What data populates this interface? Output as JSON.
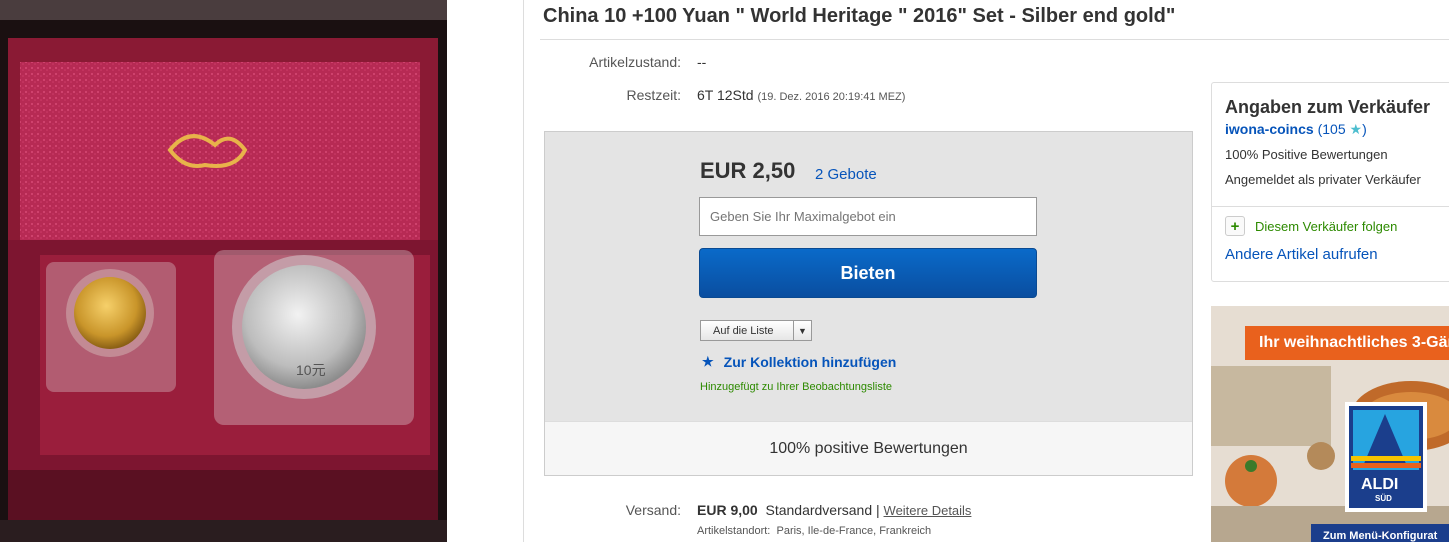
{
  "title": "China 10 +100 Yuan \" World Heritage \" 2016\" Set - Silber end gold\"",
  "condition": {
    "label": "Artikelzustand:",
    "value": "--"
  },
  "time_left": {
    "label": "Restzeit:",
    "value": "6T 12Std",
    "detail": "(19. Dez. 2016   20:19:41 MEZ)"
  },
  "bid": {
    "price": "EUR 2,50",
    "bids_link": "2 Gebote",
    "input_placeholder": "Geben Sie Ihr Maximalgebot ein",
    "button_label": "Bieten",
    "list_select": "Auf die Liste",
    "collection_link": "Zur Kollektion hinzufügen",
    "watch_note": "Hinzugefügt zu Ihrer Beobachtungsliste",
    "positive_feedback": "100% positive Bewertungen"
  },
  "shipping": {
    "label": "Versand:",
    "price": "EUR 9,00",
    "method": "Standardversand |",
    "details_link": "Weitere Details",
    "location_label": "Artikelstandort:",
    "location": "Paris, Ile-de-France, Frankreich"
  },
  "seller": {
    "heading": "Angaben zum Verkäufer",
    "username": "iwona-coincs",
    "score_open": "(105",
    "score_close": ")",
    "positive": "100% Positive Bewertungen",
    "registered": "Angemeldet als privater Verkäufer",
    "follow": "Diesem Verkäufer folgen",
    "other_items": "Andere Artikel aufrufen"
  },
  "ad": {
    "banner": "Ihr weihnachtliches 3-Gän",
    "brand": "ALDI",
    "brand_sub": "SÜD",
    "footer": "Zum Menü-Konfigurat"
  },
  "coin": {
    "value_mark": "10元"
  },
  "colors": {
    "link": "#0654ba",
    "button": "#0a5cb5",
    "green": "#2d8a00",
    "ad_orange": "#e9611d"
  }
}
